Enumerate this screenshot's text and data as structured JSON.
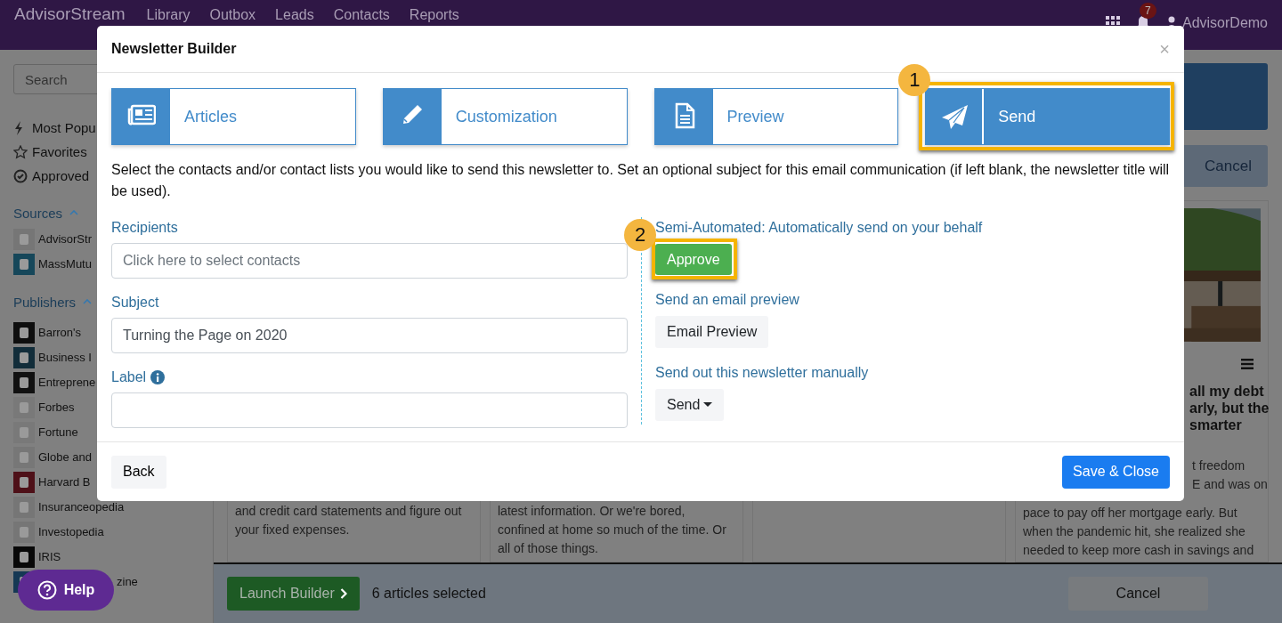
{
  "top_nav": {
    "brand": "AdvisorStream",
    "links": [
      "Library",
      "Outbox",
      "Leads",
      "Contacts",
      "Reports"
    ],
    "notification_count": "7",
    "user_name": "AdvisorDemo"
  },
  "sidebar": {
    "search": {
      "placeholder": "Search"
    },
    "filters": [
      {
        "kind": "popular",
        "label": "Most Popu"
      },
      {
        "kind": "favorites",
        "label": "Favorites"
      },
      {
        "kind": "approved",
        "label": "Approved"
      }
    ],
    "sections": [
      {
        "title": "Sources",
        "expanded": true,
        "items": [
          {
            "label": "AdvisorStr",
            "color": "#767676"
          },
          {
            "label": "MassMutu",
            "color": "#16475a"
          }
        ]
      },
      {
        "title": "Publishers",
        "expanded": true,
        "items": [
          {
            "label": "Barron's",
            "color": "#0e0e0e"
          },
          {
            "label": "Business I",
            "color": "#122d3a"
          },
          {
            "label": "Entreprene",
            "color": "#111111"
          },
          {
            "label": "Forbes",
            "color": "#797979"
          },
          {
            "label": "Fortune",
            "color": "#797979"
          },
          {
            "label": "Globe and",
            "color": "#777777"
          },
          {
            "label": "Harvard B",
            "color": "#4e1018"
          },
          {
            "label": "Insuranceopedia",
            "color": "#767676"
          },
          {
            "label": "Investopedia",
            "color": "#767676"
          },
          {
            "label": "IRIS",
            "color": "#080808"
          },
          {
            "label": "zine",
            "color": "#153854"
          }
        ]
      }
    ]
  },
  "help_button": {
    "label": "Help"
  },
  "main": {
    "cancel_button": {
      "label": "Cancel"
    },
    "cards": [
      {
        "kind": "text",
        "lines": [
          "and credit card statements and figure out",
          "your fixed expenses."
        ]
      },
      {
        "kind": "text",
        "lines": [
          "latest information. Or we're bored,",
          "confined at home so much of the time. Or",
          "all of those things."
        ]
      },
      {
        "kind": "empty"
      },
      {
        "kind": "feature",
        "headline_tail": [
          "all my debt",
          "arly, but the",
          "smarter"
        ],
        "excerpt_tail": [
          "t freedom",
          "E and was on"
        ],
        "excerpt": [
          "pace to pay off her mortgage early. But",
          "when the pandemic hit, she realized she",
          "needed to keep more cash in savings and"
        ]
      }
    ]
  },
  "bottom_bar": {
    "launch_button": {
      "label": "Launch Builder"
    },
    "selection_count": "6 articles selected",
    "cancel_button": {
      "label": "Cancel"
    }
  },
  "modal": {
    "title": "Newsletter Builder",
    "close_label": "×",
    "steps": [
      {
        "kind": "articles",
        "label": "Articles",
        "selected": false,
        "highlighted": false
      },
      {
        "kind": "customization",
        "label": "Customization",
        "selected": false,
        "highlighted": false
      },
      {
        "kind": "preview",
        "label": "Preview",
        "selected": false,
        "highlighted": false
      },
      {
        "kind": "send",
        "label": "Send",
        "selected": true,
        "highlighted": true,
        "callout": "1"
      }
    ],
    "instructions": "Select the contacts and/or contact lists you would like to send this newsletter to. Set an optional subject for this email communication (if left blank, the newsletter title will be used).",
    "form": {
      "recipients": {
        "label": "Recipients",
        "placeholder": "Click here to select contacts"
      },
      "subject": {
        "label": "Subject",
        "value": "Turning the Page on 2020"
      },
      "label_field": {
        "label": "Label"
      }
    },
    "send_options": [
      {
        "kind": "approve",
        "heading": "Semi-Automated: Automatically send on your behalf",
        "button": "Approve",
        "highlighted": true,
        "callout": "2"
      },
      {
        "kind": "preview",
        "heading": "Send an email preview",
        "button": "Email Preview",
        "highlighted": false
      },
      {
        "kind": "dropdown",
        "heading": "Send out this newsletter manually",
        "button": "Send",
        "highlighted": false
      }
    ],
    "footer": {
      "back_button": "Back",
      "save_button": "Save & Close"
    }
  }
}
